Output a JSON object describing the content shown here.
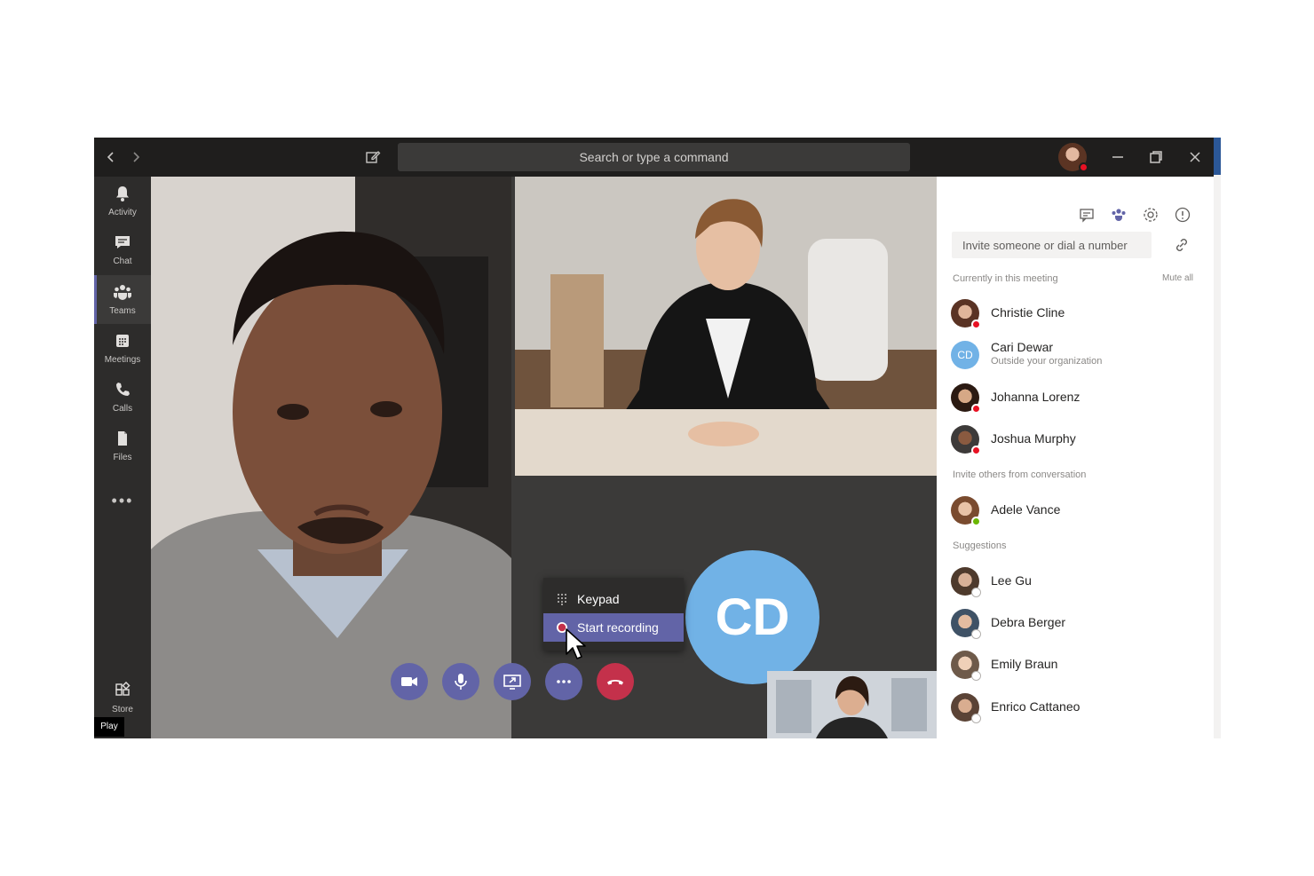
{
  "titlebar": {
    "search_placeholder": "Search or type a command",
    "icons": [
      "chevron-left-icon",
      "chevron-right-icon",
      "compose-icon",
      "minimize-icon",
      "restore-icon",
      "close-icon"
    ]
  },
  "rail": {
    "items": [
      {
        "label": "Activity",
        "icon": "bell-icon"
      },
      {
        "label": "Chat",
        "icon": "chat-icon"
      },
      {
        "label": "Teams",
        "icon": "teams-icon",
        "active": true
      },
      {
        "label": "Meetings",
        "icon": "calendar-icon"
      },
      {
        "label": "Calls",
        "icon": "phone-icon"
      },
      {
        "label": "Files",
        "icon": "file-icon"
      }
    ],
    "more": "•••",
    "store_label": "Store",
    "play_badge": "Play"
  },
  "stage": {
    "avatar_initials": "CD",
    "menu": {
      "items": [
        {
          "label": "Keypad",
          "icon": "keypad-icon"
        },
        {
          "label": "Start recording",
          "icon": "record-icon",
          "highlighted": true
        }
      ]
    },
    "controls": [
      "camera-icon",
      "microphone-icon",
      "share-screen-icon",
      "more-icon",
      "hangup-icon"
    ]
  },
  "panel": {
    "invite_placeholder": "Invite someone or dial a number",
    "current_header": "Currently in this meeting",
    "mute_all": "Mute all",
    "current": [
      {
        "name": "Christie Cline",
        "status": "red"
      },
      {
        "name": "Cari Dewar",
        "sub": "Outside your organization",
        "initials": "CD"
      },
      {
        "name": "Johanna Lorenz",
        "status": "red"
      },
      {
        "name": "Joshua Murphy",
        "status": "red"
      }
    ],
    "invite_header": "Invite others from conversation",
    "invite_people": [
      {
        "name": "Adele Vance",
        "status": "green"
      }
    ],
    "suggestions_header": "Suggestions",
    "suggestions": [
      {
        "name": "Lee Gu"
      },
      {
        "name": "Debra Berger"
      },
      {
        "name": "Emily Braun"
      },
      {
        "name": "Enrico Cattaneo"
      }
    ]
  },
  "colors": {
    "accent": "#6264a7",
    "hangup": "#c4314b",
    "avatar_blue": "#71b2e6",
    "busy": "#e81123",
    "available": "#6bb700"
  }
}
